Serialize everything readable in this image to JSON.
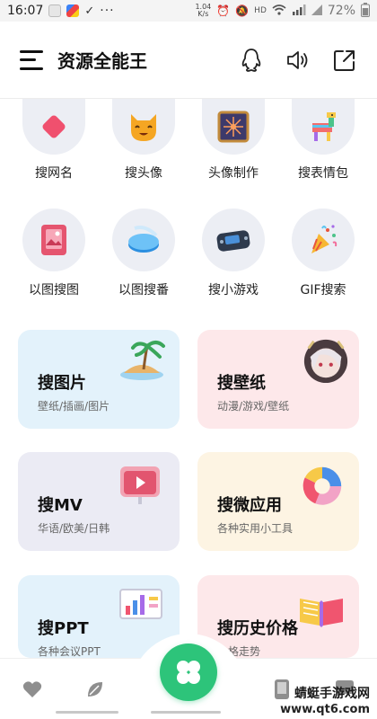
{
  "status_bar": {
    "time": "16:07",
    "network_speed_top": "1.04",
    "network_speed_unit": "K/s",
    "network_type": "HD",
    "battery": "72%"
  },
  "header": {
    "title": "资源全能王",
    "icons": [
      "menu-icon",
      "qq-icon",
      "speaker-icon",
      "share-icon"
    ]
  },
  "grid": {
    "row1": [
      {
        "label": "搜网名",
        "icon": "red-diamond-icon"
      },
      {
        "label": "搜头像",
        "icon": "cat-face-icon"
      },
      {
        "label": "头像制作",
        "icon": "sparkle-frame-icon"
      },
      {
        "label": "搜表情包",
        "icon": "pinata-icon"
      }
    ],
    "row2": [
      {
        "label": "以图搜图",
        "icon": "photo-frame-icon"
      },
      {
        "label": "以图搜番",
        "icon": "blue-disc-icon"
      },
      {
        "label": "搜小游戏",
        "icon": "gamepad-icon"
      },
      {
        "label": "GIF搜索",
        "icon": "party-popper-icon"
      }
    ]
  },
  "cards": [
    {
      "title": "搜图片",
      "subtitle": "壁纸/插画/图片",
      "icon": "island-icon",
      "bg": "#e3f2fb"
    },
    {
      "title": "搜壁纸",
      "subtitle": "动漫/游戏/壁纸",
      "icon": "anime-avatar-icon",
      "bg": "#fde8ea"
    },
    {
      "title": "搜MV",
      "subtitle": "华语/欧美/日韩",
      "icon": "video-play-icon",
      "bg": "#ebebf4"
    },
    {
      "title": "搜微应用",
      "subtitle": "各种实用小工具",
      "icon": "pie-chart-icon",
      "bg": "#fdf4e3"
    },
    {
      "title": "搜PPT",
      "subtitle": "各种会议PPT",
      "icon": "presentation-board-icon",
      "bg": "#e3f2fb"
    },
    {
      "title": "搜历史价格",
      "subtitle": "价格走势",
      "icon": "open-book-icon",
      "bg": "#fde8ea"
    }
  ],
  "bottom_nav": {
    "items": [
      "heart-icon",
      "leaf-icon",
      "clover-icon",
      "phone-icon",
      "chat-icon"
    ],
    "accent": "#2dc47a"
  },
  "watermark": {
    "brand": "蜻蜓手游戏网",
    "url": "www.qt6.com"
  }
}
